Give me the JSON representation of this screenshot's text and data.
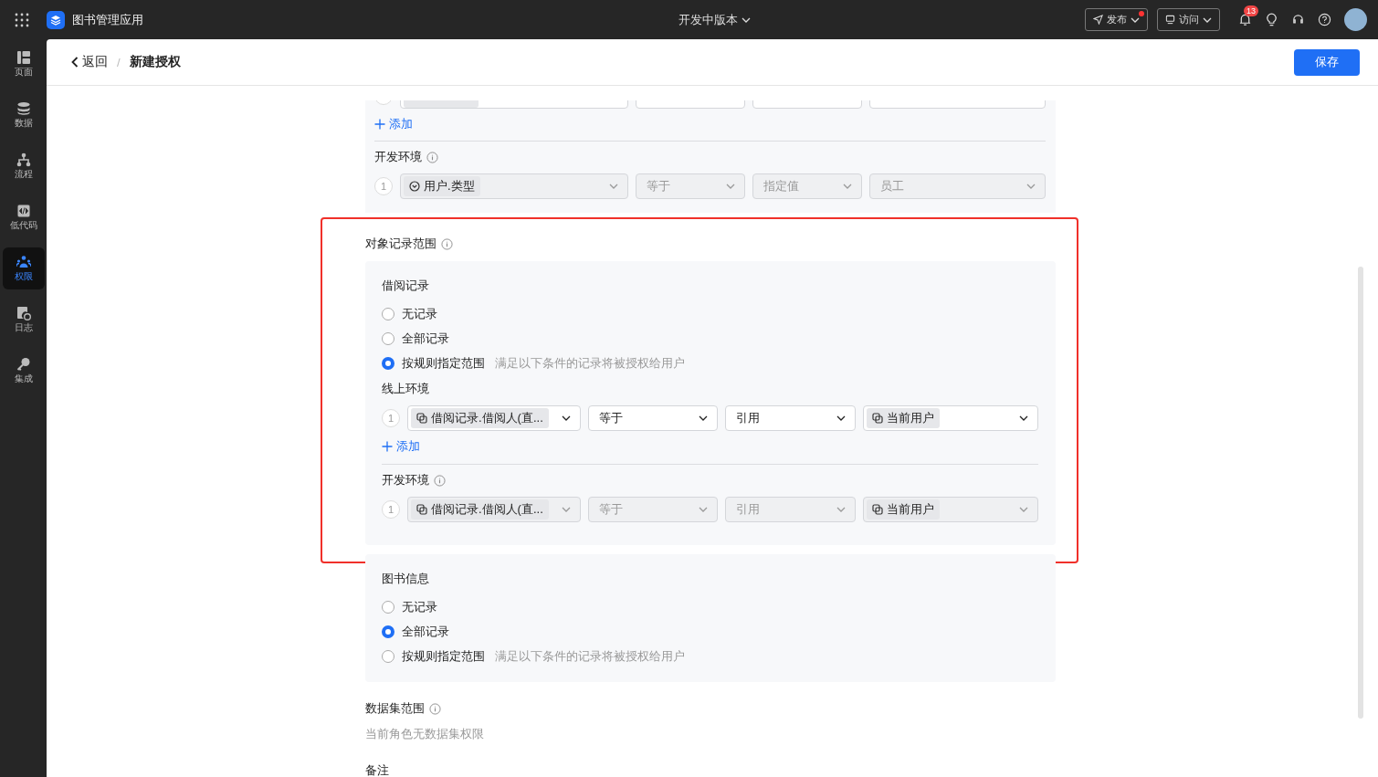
{
  "topbar": {
    "app_name": "图书管理应用",
    "version": "开发中版本",
    "publish": "发布",
    "publish_dot": true,
    "visit": "访问",
    "notification_count": "13"
  },
  "sidebar": {
    "items": [
      {
        "label": "页面",
        "selected": false
      },
      {
        "label": "数据",
        "selected": false
      },
      {
        "label": "流程",
        "selected": false
      },
      {
        "label": "低代码",
        "selected": false
      },
      {
        "label": "权限",
        "selected": true
      },
      {
        "label": "日志",
        "selected": false
      },
      {
        "label": "集成",
        "selected": false
      }
    ]
  },
  "header": {
    "back": "返回",
    "separator": "/",
    "title": "新建授权",
    "save": "保存"
  },
  "upper_section": {
    "add": "添加",
    "dev": {
      "label": "开发环境",
      "rules": [
        {
          "index": "1",
          "field": {
            "text": "用户.类型",
            "kind": "option"
          },
          "operator": "等于",
          "value_type": "指定值",
          "value": {
            "text": "员工",
            "kind": "plain"
          },
          "disabled": true
        }
      ]
    }
  },
  "record_scope": {
    "title": "对象记录范围",
    "highlighted": true,
    "groups": [
      {
        "title": "借阅记录",
        "options": [
          {
            "label": "无记录",
            "selected": false
          },
          {
            "label": "全部记录",
            "selected": false
          },
          {
            "label": "按规则指定范围",
            "hint": "满足以下条件的记录将被授权给用户",
            "selected": true
          }
        ],
        "online": {
          "label": "线上环境",
          "rules": [
            {
              "index": "1",
              "field": {
                "text": "借阅记录.借阅人(直...",
                "kind": "link"
              },
              "operator": "等于",
              "value_type": "引用",
              "value": {
                "text": "当前用户",
                "kind": "link"
              },
              "disabled": false
            }
          ],
          "add": "添加"
        },
        "dev": {
          "label": "开发环境",
          "rules": [
            {
              "index": "1",
              "field": {
                "text": "借阅记录.借阅人(直...",
                "kind": "link"
              },
              "operator": "等于",
              "value_type": "引用",
              "value": {
                "text": "当前用户",
                "kind": "link"
              },
              "disabled": true
            }
          ]
        }
      },
      {
        "title": "图书信息",
        "options": [
          {
            "label": "无记录",
            "selected": false
          },
          {
            "label": "全部记录",
            "selected": true
          },
          {
            "label": "按规则指定范围",
            "hint": "满足以下条件的记录将被授权给用户",
            "selected": false
          }
        ]
      }
    ]
  },
  "dataset_scope": {
    "title": "数据集范围",
    "empty_text": "当前角色无数据集权限"
  },
  "remark": {
    "title": "备注"
  }
}
